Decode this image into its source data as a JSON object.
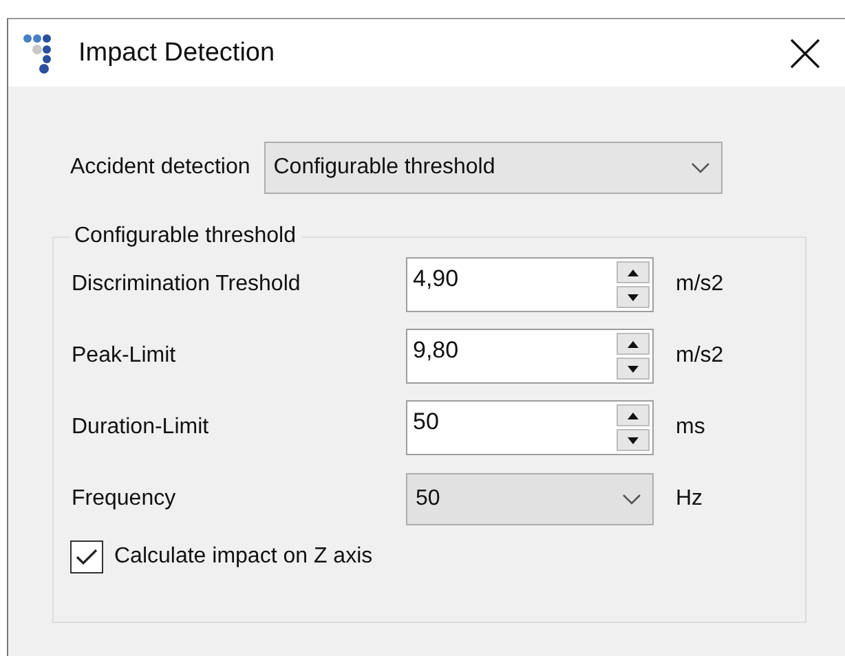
{
  "window": {
    "title": "Impact Detection"
  },
  "accident_detection": {
    "label": "Accident detection",
    "value": "Configurable threshold"
  },
  "group": {
    "title": "Configurable threshold",
    "fields": [
      {
        "kind": "spinner",
        "label": "Discrimination Treshold",
        "value": "4,90",
        "unit": "m/s2"
      },
      {
        "kind": "spinner",
        "label": "Peak-Limit",
        "value": "9,80",
        "unit": "m/s2"
      },
      {
        "kind": "spinner",
        "label": "Duration-Limit",
        "value": "50",
        "unit": "ms"
      },
      {
        "kind": "dropdown",
        "label": "Frequency",
        "value": "50",
        "unit": "Hz"
      }
    ],
    "checkbox": {
      "label": "Calculate impact on Z axis",
      "checked": true
    }
  }
}
